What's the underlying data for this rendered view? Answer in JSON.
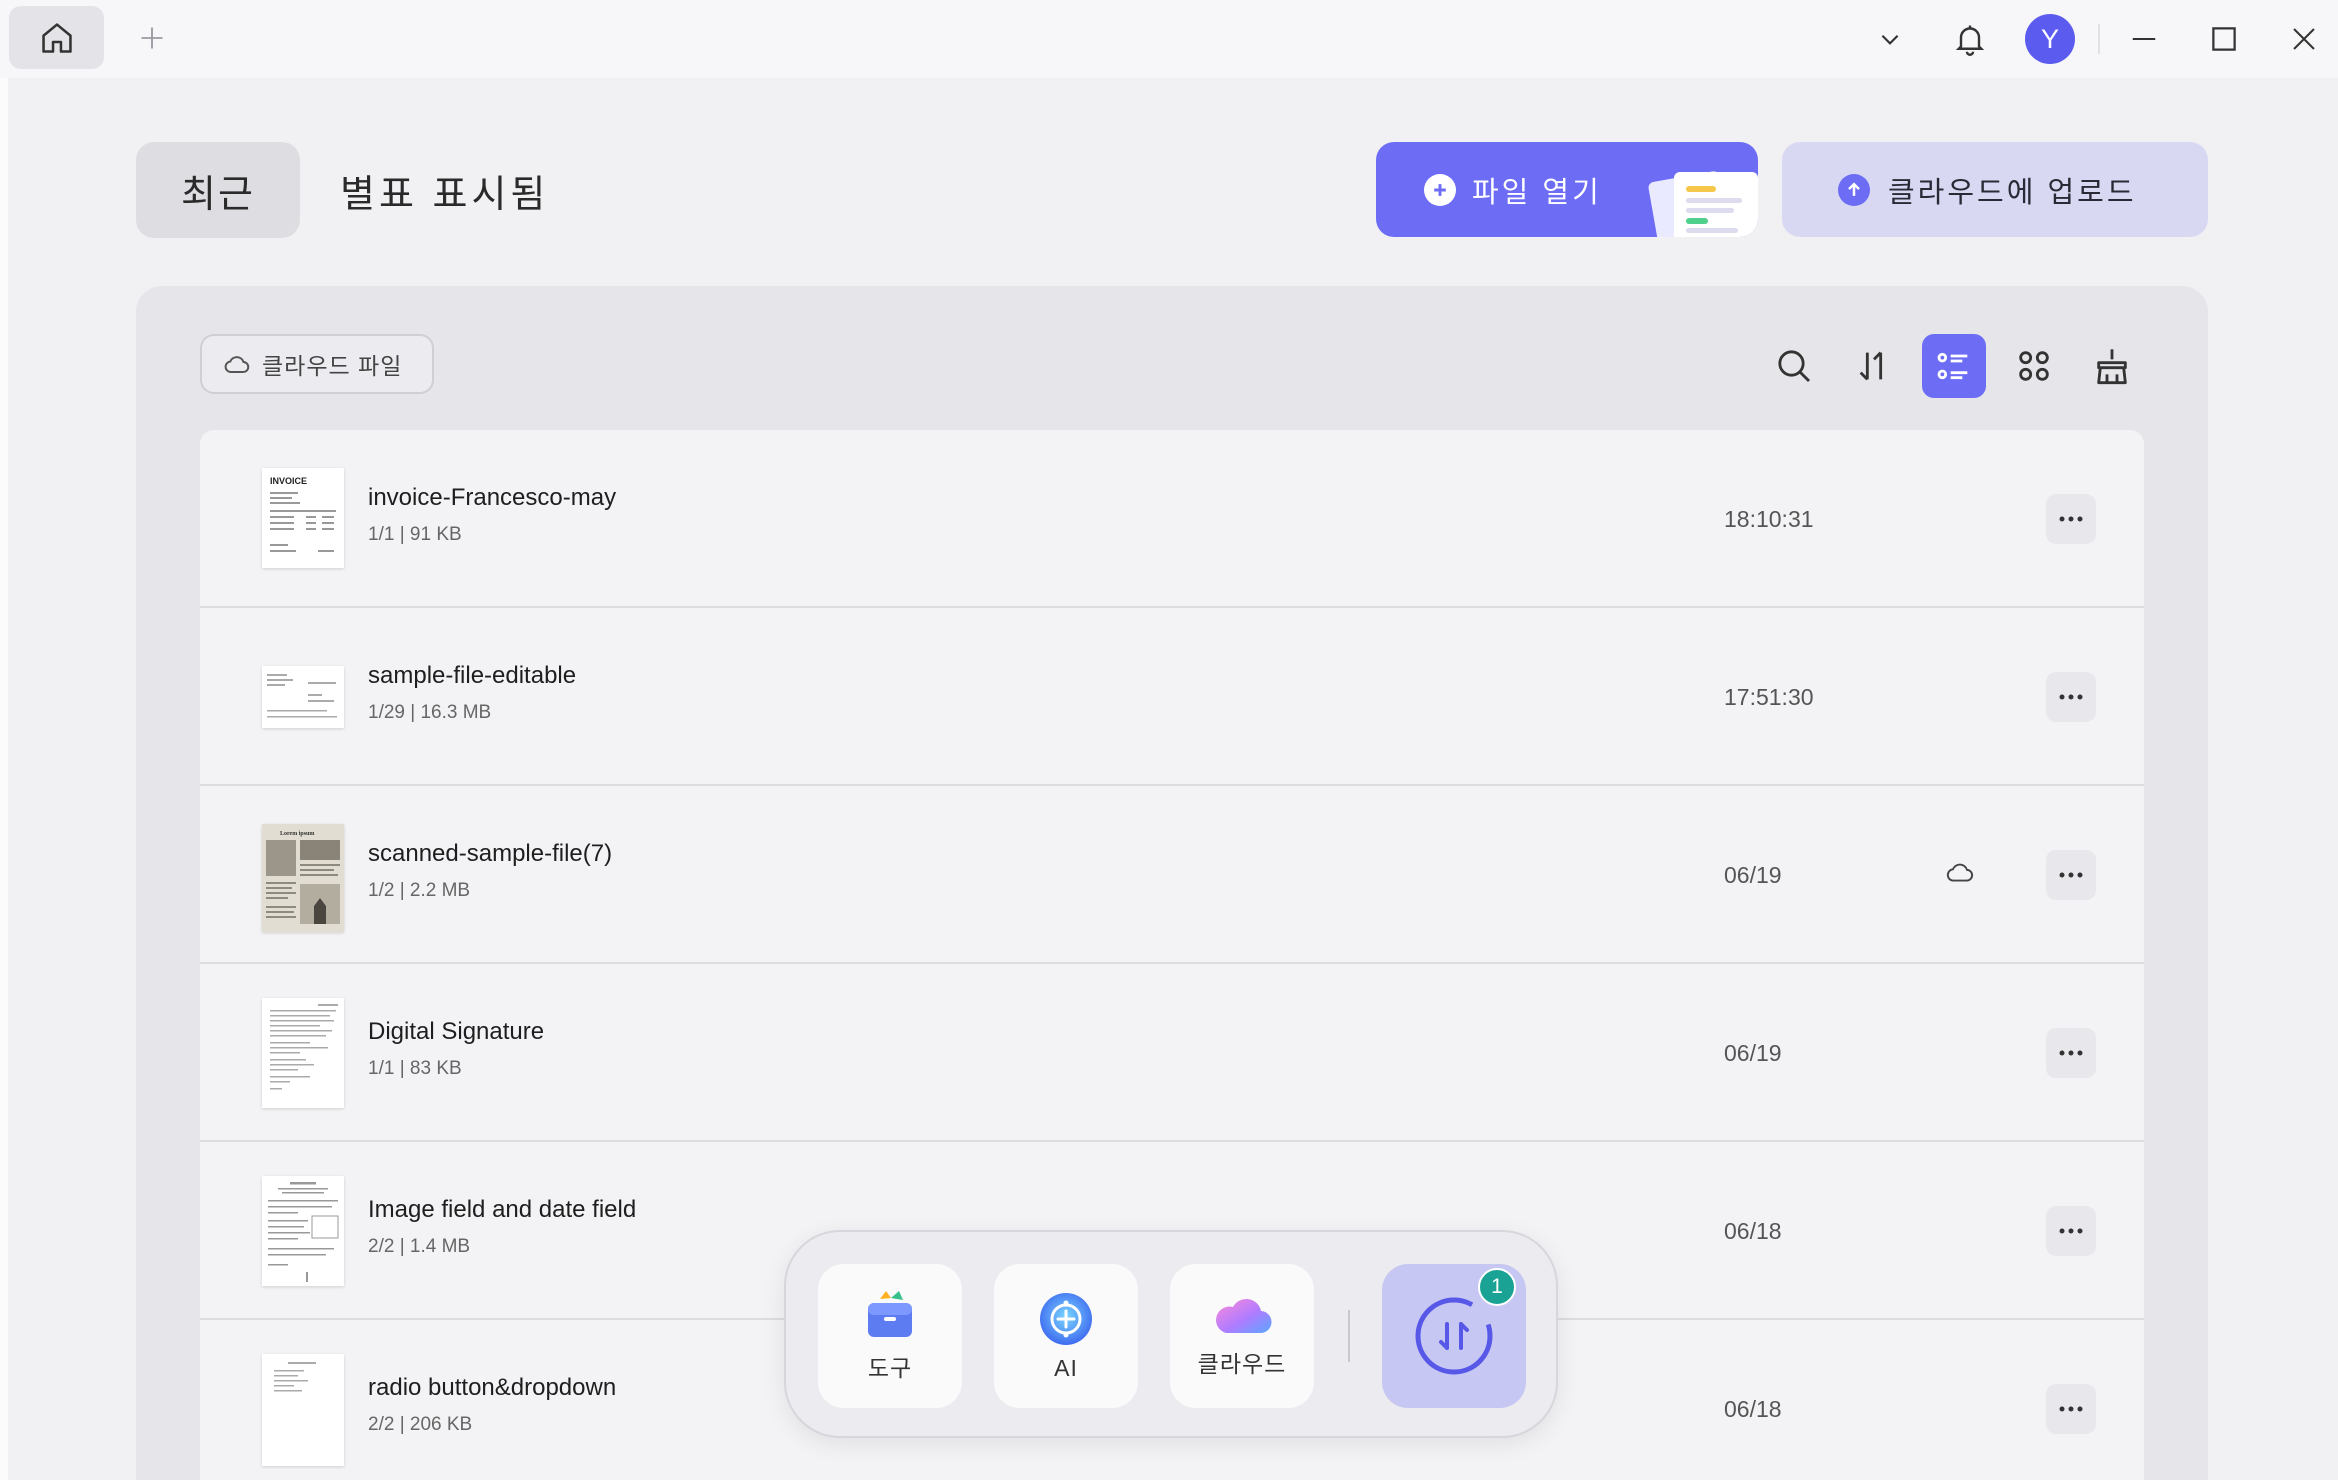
{
  "titlebar": {
    "icons": [
      "home-icon",
      "plus-icon",
      "chevron-down-icon",
      "bell-icon",
      "minimize-icon",
      "maximize-icon",
      "close-icon"
    ],
    "avatar_letter": "Y"
  },
  "header": {
    "tab_recent": "최근",
    "tab_starred": "별표 표시됨",
    "open_file": "파일 열기",
    "upload_cloud": "클라우드에 업로드"
  },
  "panel": {
    "cloud_chip": "클라우드 파일",
    "toolbar_icons": [
      "search-icon",
      "sort-icon",
      "list-view-icon",
      "grid-view-icon",
      "cleanup-icon"
    ],
    "active_view": "list"
  },
  "files": [
    {
      "name": "invoice-Francesco-may",
      "meta": "1/1 | 91 KB",
      "time": "18:10:31",
      "cloud": false
    },
    {
      "name": "sample-file-editable",
      "meta": "1/29 | 16.3 MB",
      "time": "17:51:30",
      "cloud": false
    },
    {
      "name": "scanned-sample-file(7)",
      "meta": "1/2 | 2.2 MB",
      "time": "06/19",
      "cloud": true
    },
    {
      "name": "Digital Signature",
      "meta": "1/1 | 83 KB",
      "time": "06/19",
      "cloud": false
    },
    {
      "name": "Image field and date field",
      "meta": "2/2 | 1.4 MB",
      "time": "06/18",
      "cloud": false
    },
    {
      "name": "radio button&dropdown",
      "meta": "2/2 | 206 KB",
      "time": "06/18",
      "cloud": false
    }
  ],
  "thumb_text": {
    "invoice": "INVOICE",
    "scanned": "Lorem ipsum"
  },
  "dock": {
    "tools": "도구",
    "ai": "AI",
    "cloud": "클라우드",
    "badge_count": "1"
  },
  "colors": {
    "accent": "#6c6cf5",
    "accent_light": "#d8d8f3",
    "badge": "#1aa394"
  }
}
